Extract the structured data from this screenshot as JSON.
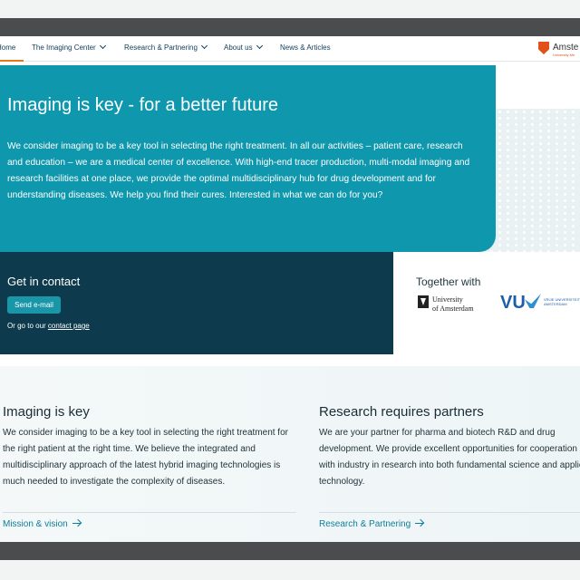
{
  "nav": {
    "items": [
      {
        "label": "Home",
        "has_dropdown": false
      },
      {
        "label": "The Imaging Center",
        "has_dropdown": true
      },
      {
        "label": "Research & Partnering",
        "has_dropdown": true
      },
      {
        "label": "About us",
        "has_dropdown": true
      },
      {
        "label": "News & Articles",
        "has_dropdown": false
      }
    ],
    "logo_text": "Amste",
    "logo_sub": "University Me",
    "active_color": "#e07a1f"
  },
  "hero": {
    "title": "Imaging is key - for a better future",
    "text": "We consider imaging to be a key tool in selecting the right treatment. In all our activities – patient care, research and education – we are a medical center of excellence. With high-end tracer production, multi-modal imaging and research facilities at one place, we provide the optimal multidisciplinary hub for drug development and for understanding diseases. We help you find their cures. Interested in what we can do for you?",
    "bg_color": "#0e97ad"
  },
  "contact": {
    "title": "Get in contact",
    "email_button": "Send e-mail",
    "link_prefix": "Or go to our",
    "link_text": "contact page"
  },
  "partners": {
    "title": "Together with",
    "uva_line1": "University",
    "uva_line2": "of Amsterdam",
    "vu_big": "VU",
    "vu_small": "VRIJE UNIVERSITEIT AMSTERDAM"
  },
  "columns": [
    {
      "title": "Imaging is key",
      "text": "We consider imaging to be a key tool in selecting the right treatment for the right patient at the right time. We believe the integrated and multidisciplinary approach of the latest hybrid imaging technologies is much needed to investigate the complexity of diseases.",
      "link": "Mission & vision"
    },
    {
      "title": "Research requires partners",
      "text": "We are your partner for pharma and biotech R&D and drug development. We provide excellent opportunities for cooperation with industry in research into both fundamental science and applied technology.",
      "link": "Research & Partnering"
    }
  ]
}
